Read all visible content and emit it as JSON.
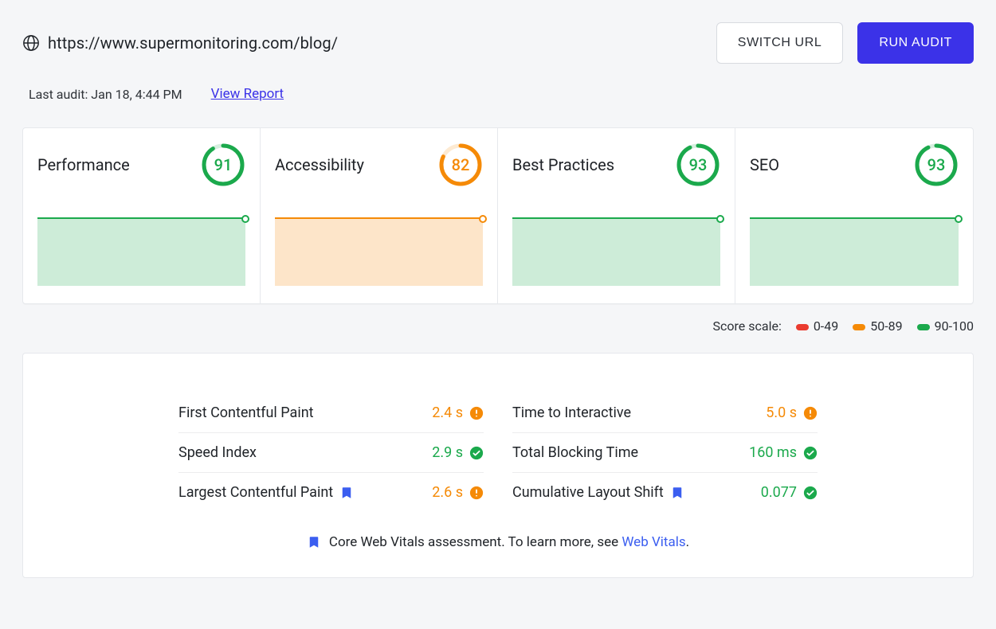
{
  "header": {
    "url": "https://www.supermonitoring.com/blog/",
    "switch_url_label": "SWITCH URL",
    "run_audit_label": "RUN AUDIT",
    "last_audit": "Last audit: Jan 18, 4:44 PM",
    "view_report": "View Report"
  },
  "cards": [
    {
      "title": "Performance",
      "score": 91,
      "color": "green"
    },
    {
      "title": "Accessibility",
      "score": 82,
      "color": "orange"
    },
    {
      "title": "Best Practices",
      "score": 93,
      "color": "green"
    },
    {
      "title": "SEO",
      "score": 93,
      "color": "green"
    }
  ],
  "scale": {
    "label": "Score scale:",
    "ranges": [
      "0-49",
      "50-89",
      "90-100"
    ]
  },
  "metrics": {
    "left": [
      {
        "name": "First Contentful Paint",
        "value": "2.4 s",
        "status": "warn",
        "bookmark": false
      },
      {
        "name": "Speed Index",
        "value": "2.9 s",
        "status": "ok",
        "bookmark": false
      },
      {
        "name": "Largest Contentful Paint",
        "value": "2.6 s",
        "status": "warn",
        "bookmark": true
      }
    ],
    "right": [
      {
        "name": "Time to Interactive",
        "value": "5.0 s",
        "status": "warn",
        "bookmark": false
      },
      {
        "name": "Total Blocking Time",
        "value": "160 ms",
        "status": "ok",
        "bookmark": false
      },
      {
        "name": "Cumulative Layout Shift",
        "value": "0.077",
        "status": "ok",
        "bookmark": true
      }
    ]
  },
  "footer": {
    "text_before": "Core Web Vitals assessment. To learn more, see ",
    "link_text": "Web Vitals",
    "text_after": "."
  },
  "colors": {
    "green": "#1ba94c",
    "orange": "#f58a07",
    "red": "#ea3b2f"
  }
}
